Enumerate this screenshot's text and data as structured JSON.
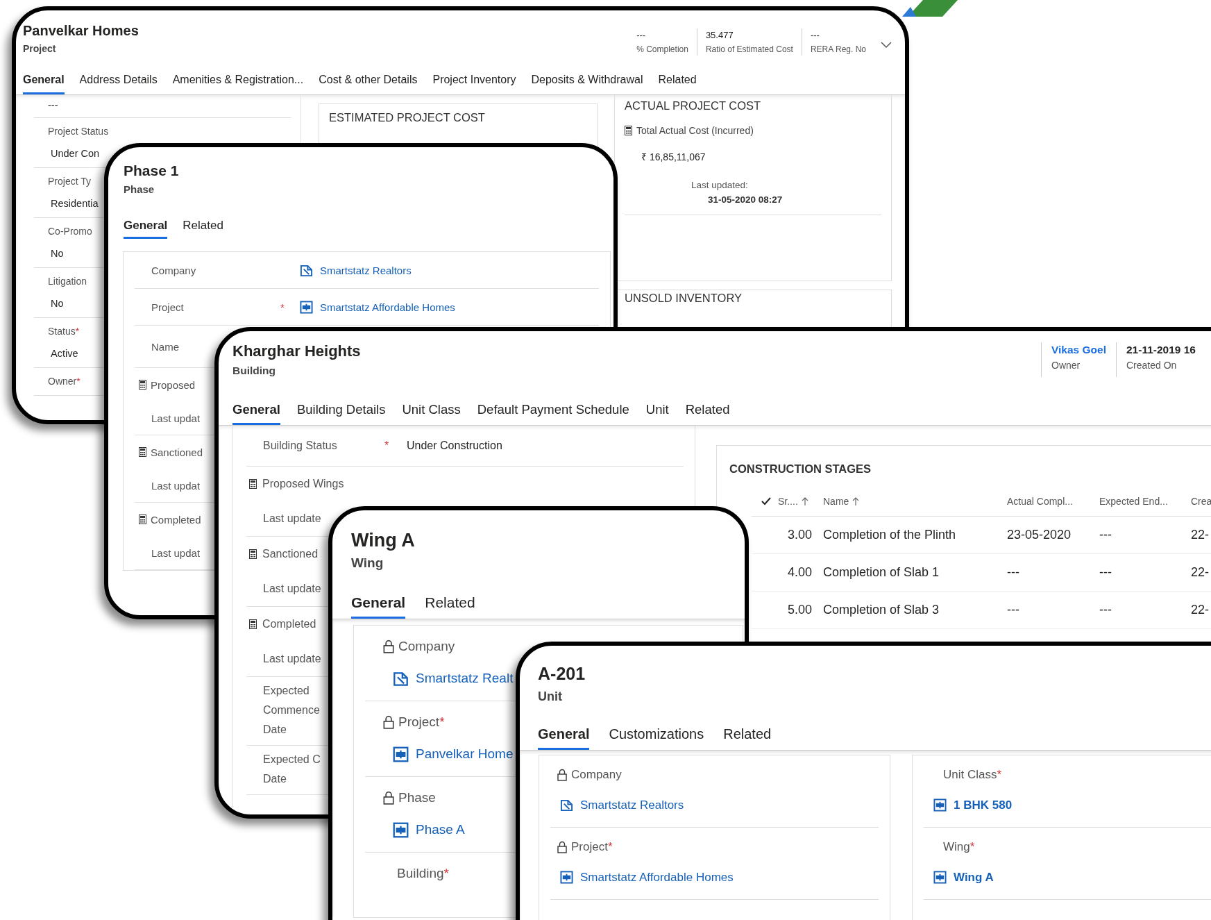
{
  "project_window": {
    "title": "Panvelkar Homes",
    "subtitle": "Project",
    "header_fields": [
      {
        "value": "---",
        "label": "% Completion"
      },
      {
        "value": "35.477",
        "label": "Ratio of Estimated Cost"
      },
      {
        "value": "---",
        "label": "RERA Reg. No"
      }
    ],
    "tabs": [
      {
        "label": "General",
        "selected": true
      },
      {
        "label": "Address Details",
        "selected": false
      },
      {
        "label": "Amenities & Registration...",
        "selected": false
      },
      {
        "label": "Cost & other Details",
        "selected": false
      },
      {
        "label": "Project Inventory",
        "selected": false
      },
      {
        "label": "Deposits & Withdrawal",
        "selected": false
      },
      {
        "label": "Related",
        "selected": false
      }
    ],
    "left_fields": [
      {
        "value": "---"
      },
      {
        "label": "Project Status",
        "value": "Under Con"
      },
      {
        "label": "Project Ty",
        "value": "Residentia"
      },
      {
        "label": "Co-Promo",
        "value": "No"
      },
      {
        "label": "Litigation",
        "value": "No"
      },
      {
        "label": "Status",
        "required_mark": "*",
        "value": "Active"
      },
      {
        "label": "Owner",
        "required_mark": "*"
      }
    ],
    "estimated_cost": {
      "title": "ESTIMATED PROJECT COST"
    },
    "actual_cost": {
      "title": "ACTUAL PROJECT COST",
      "field_label": "Total Actual Cost (Incurred)",
      "amount": "₹ 16,85,11,067",
      "updated_label": "Last updated:",
      "updated_value": "31-05-2020 08:27"
    },
    "unsold_inventory": {
      "title": "UNSOLD INVENTORY"
    }
  },
  "phase_window": {
    "title": "Phase 1",
    "subtitle": "Phase",
    "tabs": [
      {
        "label": "General",
        "selected": true
      },
      {
        "label": "Related",
        "selected": false
      }
    ],
    "fields": [
      {
        "kind": "account_lookup",
        "label": "Company",
        "value": "Smartstatz Realtors"
      },
      {
        "kind": "record_lookup",
        "label": "Project",
        "required_mark": "*",
        "value": "Smartstatz Affordable Homes"
      },
      {
        "kind": "text",
        "label": "Name"
      },
      {
        "kind": "calculated",
        "label": "Proposed"
      },
      {
        "kind": "updated",
        "label": "Last updat"
      },
      {
        "kind": "calculated",
        "label": "Sanctioned"
      },
      {
        "kind": "updated",
        "label": "Last updat"
      },
      {
        "kind": "calculated",
        "label": "Completed"
      },
      {
        "kind": "updated",
        "label": "Last updat"
      }
    ]
  },
  "building_window": {
    "title": "Kharghar Heights",
    "subtitle": "Building",
    "header_fields": [
      {
        "kind": "link",
        "value": "Vikas Goel",
        "label": "Owner"
      },
      {
        "kind": "text",
        "value": "21-11-2019 16",
        "label": "Created On"
      }
    ],
    "tabs": [
      {
        "label": "General",
        "selected": true
      },
      {
        "label": "Building Details",
        "selected": false
      },
      {
        "label": "Unit Class",
        "selected": false
      },
      {
        "label": "Default Payment Schedule",
        "selected": false
      },
      {
        "label": "Unit",
        "selected": false
      },
      {
        "label": "Related",
        "selected": false
      }
    ],
    "fields": [
      {
        "kind": "choice",
        "label": "Building Status",
        "required_mark": "*",
        "value": "Under Construction"
      },
      {
        "kind": "calculated",
        "label": "Proposed Wings"
      },
      {
        "kind": "updated",
        "label": "Last update"
      },
      {
        "kind": "calculated",
        "label": "Sanctioned"
      },
      {
        "kind": "updated",
        "label": "Last update"
      },
      {
        "kind": "calculated",
        "label": "Completed"
      },
      {
        "kind": "updated",
        "label": "Last update"
      },
      {
        "kind": "multiline",
        "lines": [
          "Expected",
          "Commence",
          "Date"
        ]
      },
      {
        "kind": "multiline",
        "lines": [
          "Expected C",
          "Date"
        ]
      }
    ],
    "construction_stages": {
      "title": "CONSTRUCTION STAGES",
      "columns": [
        {
          "label": "Sr....",
          "sorted": true
        },
        {
          "label": "Name",
          "sorted": true
        },
        {
          "label": "Actual Compl..."
        },
        {
          "label": "Expected End..."
        },
        {
          "label": "Crea"
        }
      ],
      "rows": [
        {
          "cells": [
            "3.00",
            "Completion of the Plinth",
            "23-05-2020",
            "---",
            "22-"
          ]
        },
        {
          "cells": [
            "4.00",
            "Completion of Slab 1",
            "---",
            "---",
            "22-"
          ]
        },
        {
          "cells": [
            "5.00",
            "Completion of Slab 3",
            "---",
            "---",
            "22-"
          ]
        }
      ]
    }
  },
  "wing_window": {
    "title": "Wing A",
    "subtitle": "Wing",
    "tabs": [
      {
        "label": "General",
        "selected": true
      },
      {
        "label": "Related",
        "selected": false
      }
    ],
    "fields": [
      {
        "kind": "account_lookup",
        "locked": true,
        "label": "Company",
        "value": "Smartstatz Realt"
      },
      {
        "kind": "record_lookup",
        "locked": true,
        "label": "Project",
        "required_mark": "*",
        "value": "Panvelkar Home"
      },
      {
        "kind": "record_lookup",
        "locked": true,
        "label": "Phase",
        "value": "Phase A"
      },
      {
        "locked": false,
        "label": "Building",
        "required_mark": "*"
      }
    ]
  },
  "unit_window": {
    "title": "A-201",
    "subtitle": "Unit",
    "tabs": [
      {
        "label": "General",
        "selected": true
      },
      {
        "label": "Customizations",
        "selected": false
      },
      {
        "label": "Related",
        "selected": false
      }
    ],
    "left_fields": [
      {
        "kind": "account_lookup",
        "locked": true,
        "label": "Company",
        "value": "Smartstatz Realtors"
      },
      {
        "kind": "record_lookup",
        "locked": true,
        "label": "Project",
        "required_mark": "*",
        "value": "Smartstatz Affordable Homes"
      }
    ],
    "right_fields": [
      {
        "kind": "record_lookup",
        "locked": false,
        "label": "Unit Class",
        "required_mark": "*",
        "value": "1 BHK 580"
      },
      {
        "kind": "record_lookup",
        "locked": false,
        "label": "Wing",
        "required_mark": "*",
        "value": "Wing A"
      }
    ]
  }
}
